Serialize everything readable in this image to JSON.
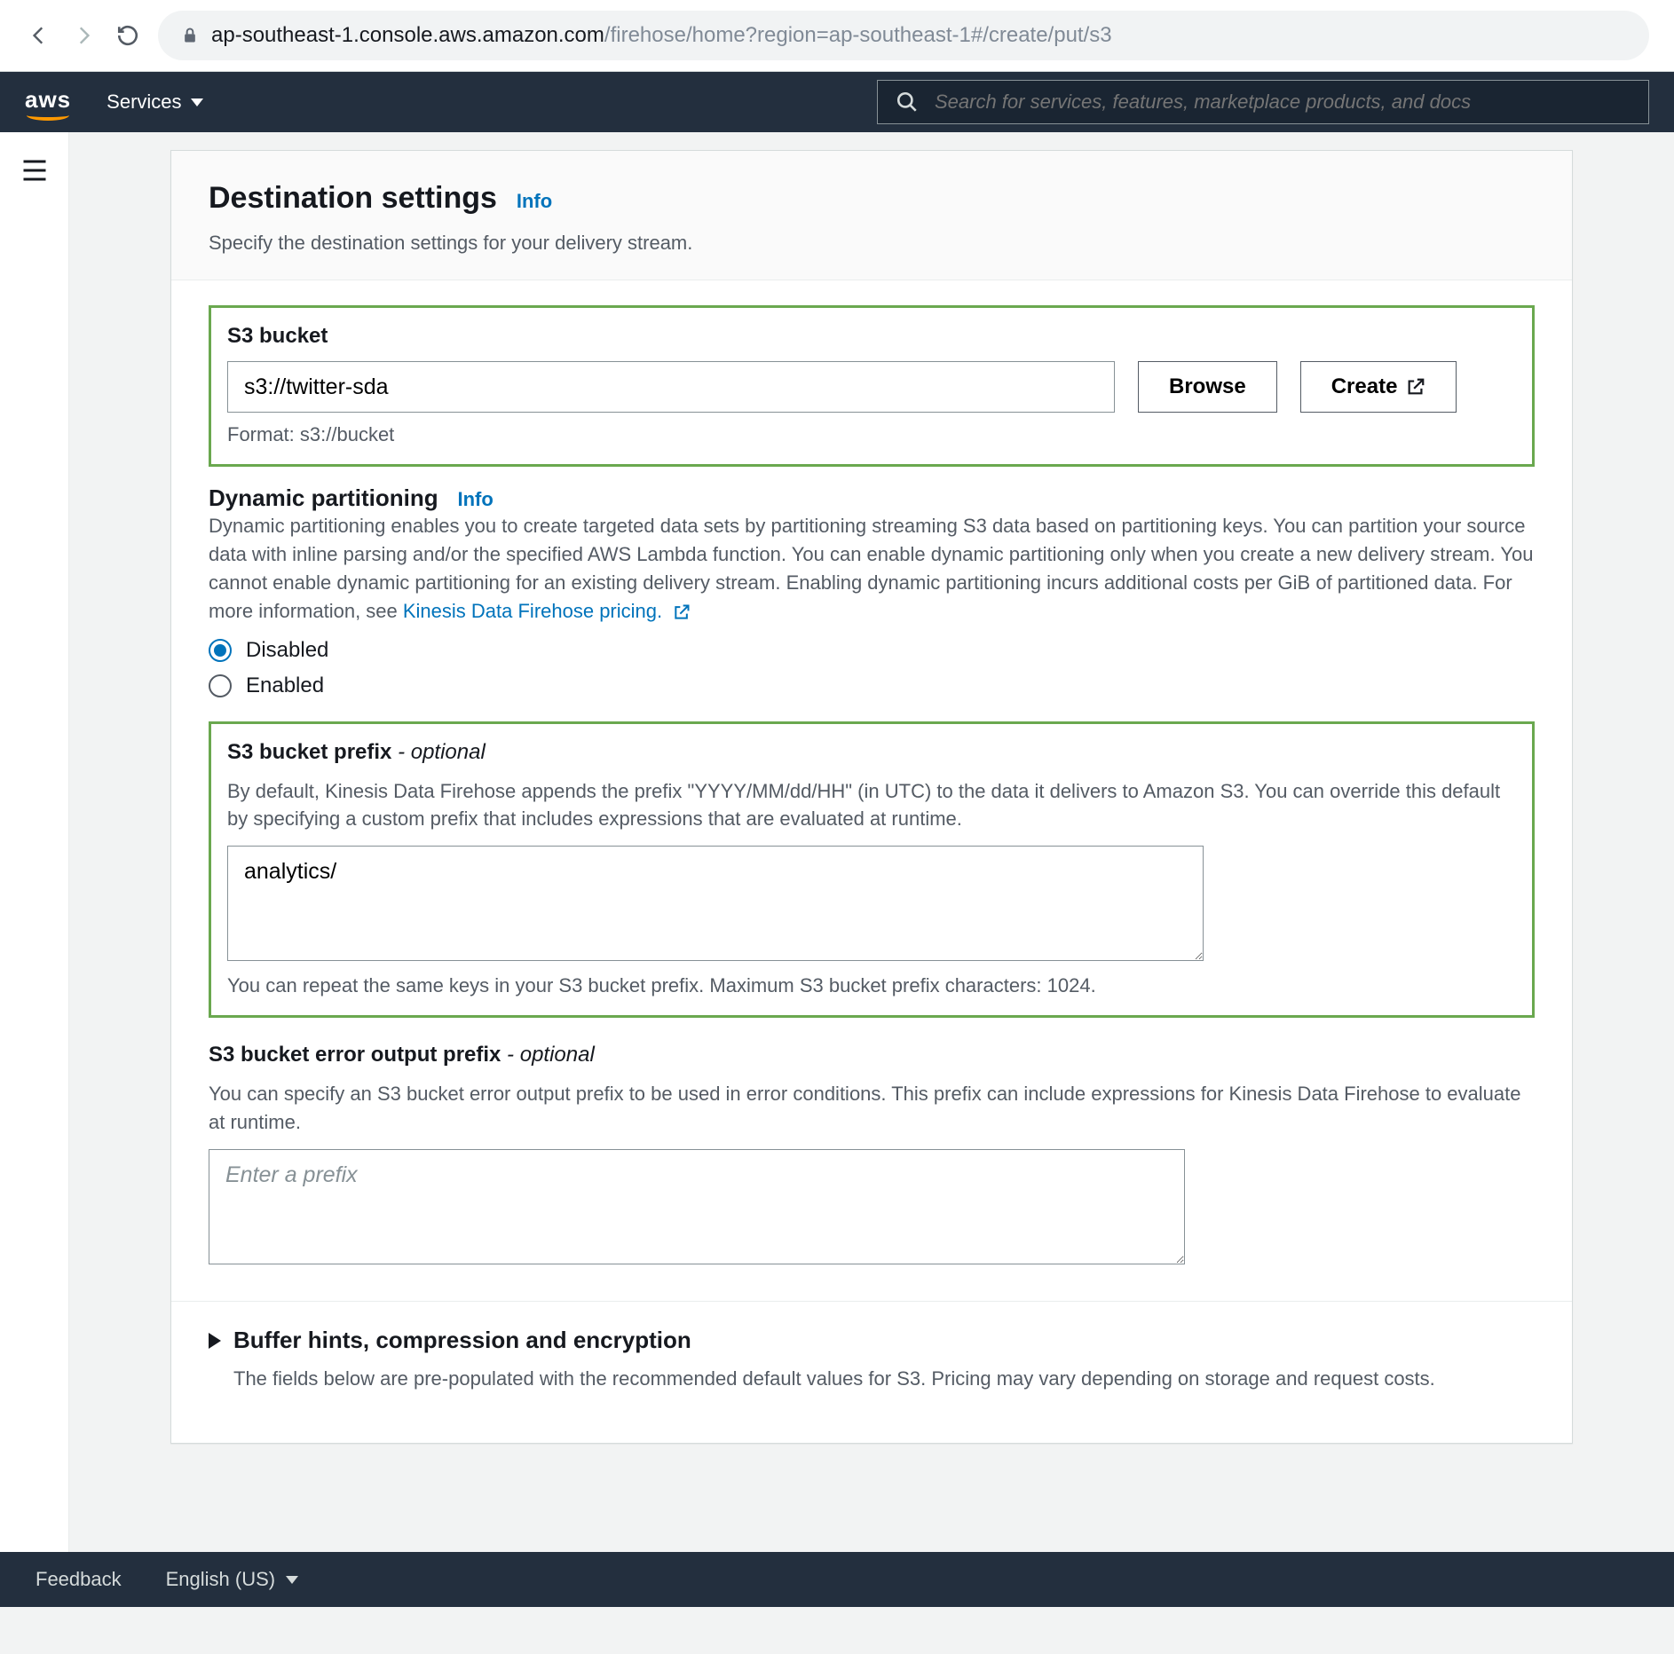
{
  "browser": {
    "host": "ap-southeast-1.console.aws.amazon.com",
    "path": "/firehose/home?region=ap-southeast-1#/create/put/s3"
  },
  "nav": {
    "logo": "aws",
    "services": "Services",
    "search_placeholder": "Search for services, features, marketplace products, and docs"
  },
  "header": {
    "title": "Destination settings",
    "info": "Info",
    "subtitle": "Specify the destination settings for your delivery stream."
  },
  "s3bucket": {
    "label": "S3 bucket",
    "value": "s3://twitter-sda",
    "browse": "Browse",
    "create": "Create",
    "hint": "Format: s3://bucket"
  },
  "dynamic": {
    "title": "Dynamic partitioning",
    "info": "Info",
    "desc": "Dynamic partitioning enables you to create targeted data sets by partitioning streaming S3 data based on partitioning keys. You can partition your source data with inline parsing and/or the specified AWS Lambda function. You can enable dynamic partitioning only when you create a new delivery stream. You cannot enable dynamic partitioning for an existing delivery stream. Enabling dynamic partitioning incurs additional costs per GiB of partitioned data. For more information, see ",
    "link": "Kinesis Data Firehose pricing.",
    "disabled": "Disabled",
    "enabled": "Enabled"
  },
  "prefix": {
    "label": "S3 bucket prefix",
    "optional": " - optional",
    "desc": "By default, Kinesis Data Firehose appends the prefix \"YYYY/MM/dd/HH\" (in UTC) to the data it delivers to Amazon S3. You can override this default by specifying a custom prefix that includes expressions that are evaluated at runtime.",
    "value": "analytics/",
    "hint": "You can repeat the same keys in your S3 bucket prefix. Maximum S3 bucket prefix characters: 1024."
  },
  "errprefix": {
    "label": "S3 bucket error output prefix",
    "optional": " - optional",
    "desc": "You can specify an S3 bucket error output prefix to be used in error conditions. This prefix can include expressions for Kinesis Data Firehose to evaluate at runtime.",
    "placeholder": "Enter a prefix"
  },
  "accordion": {
    "title": "Buffer hints, compression and encryption",
    "desc": "The fields below are pre-populated with the recommended default values for S3. Pricing may vary depending on storage and request costs."
  },
  "footer": {
    "feedback": "Feedback",
    "lang": "English (US)"
  }
}
